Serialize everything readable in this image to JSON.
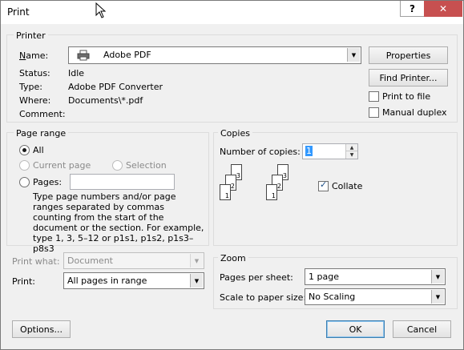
{
  "window": {
    "title": "Print",
    "help_button": "?",
    "close_button": "✕"
  },
  "printer": {
    "group_label": "Printer",
    "name_label": "Name:",
    "name_value": "Adobe PDF",
    "status_label": "Status:",
    "status_value": "Idle",
    "type_label": "Type:",
    "type_value": "Adobe PDF Converter",
    "where_label": "Where:",
    "where_value": "Documents\\*.pdf",
    "comment_label": "Comment:",
    "comment_value": "",
    "properties_button": "Properties",
    "find_printer_button": "Find Printer...",
    "print_to_file_label": "Print to file",
    "print_to_file_checked": false,
    "manual_duplex_label": "Manual duplex",
    "manual_duplex_checked": false,
    "printer_icon": "printer-icon"
  },
  "page_range": {
    "group_label": "Page range",
    "all_label": "All",
    "current_page_label": "Current page",
    "selection_label": "Selection",
    "pages_label": "Pages:",
    "pages_value": "",
    "selected": "All",
    "help_text": "Type page numbers and/or page ranges separated by commas counting from the start of the document or the section. For example, type 1, 3, 5–12 or p1s1, p1s2, p1s3–p8s3"
  },
  "copies": {
    "group_label": "Copies",
    "number_label": "Number of copies:",
    "number_value": "1",
    "collate_label": "Collate",
    "collate_checked": true,
    "collate_pages": [
      "1",
      "2",
      "3"
    ]
  },
  "print_what": {
    "label": "Print what:",
    "value": "Document"
  },
  "print": {
    "label": "Print:",
    "value": "All pages in range"
  },
  "zoom": {
    "group_label": "Zoom",
    "pages_per_sheet_label": "Pages per sheet:",
    "pages_per_sheet_value": "1 page",
    "scale_label": "Scale to paper size:",
    "scale_value": "No Scaling"
  },
  "footer": {
    "options_button": "Options...",
    "ok_button": "OK",
    "cancel_button": "Cancel"
  }
}
